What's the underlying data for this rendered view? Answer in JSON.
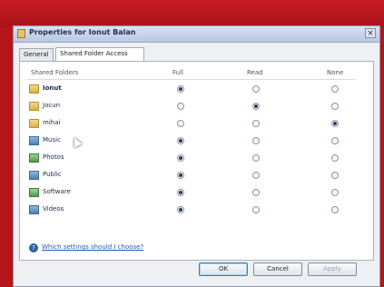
{
  "window": {
    "title": "Properties for Ionut Balan",
    "close_glyph": "×"
  },
  "tabs": [
    {
      "label": "General"
    },
    {
      "label": "Shared Folder Access"
    }
  ],
  "list": {
    "headers": [
      "Shared Folders",
      "Full",
      "Read",
      "None"
    ],
    "rows": [
      {
        "name": "Ionut",
        "icon": "folder-icon",
        "access": "Full"
      },
      {
        "name": "Jocun",
        "icon": "folder-icon",
        "access": "Read"
      },
      {
        "name": "mihai",
        "icon": "folder-icon",
        "access": "None"
      },
      {
        "name": "Music",
        "icon": "music-library-icon",
        "access": "Full"
      },
      {
        "name": "Photos",
        "icon": "photos-library-icon",
        "access": "Full"
      },
      {
        "name": "Public",
        "icon": "public-folder-icon",
        "access": "Full"
      },
      {
        "name": "Software",
        "icon": "software-folder-icon",
        "access": "Full"
      },
      {
        "name": "Videos",
        "icon": "videos-library-icon",
        "access": "Full"
      }
    ]
  },
  "help": {
    "icon": "help-icon",
    "link": "Which settings should I choose?"
  },
  "buttons": {
    "ok": "OK",
    "cancel": "Cancel",
    "apply": "Apply"
  }
}
